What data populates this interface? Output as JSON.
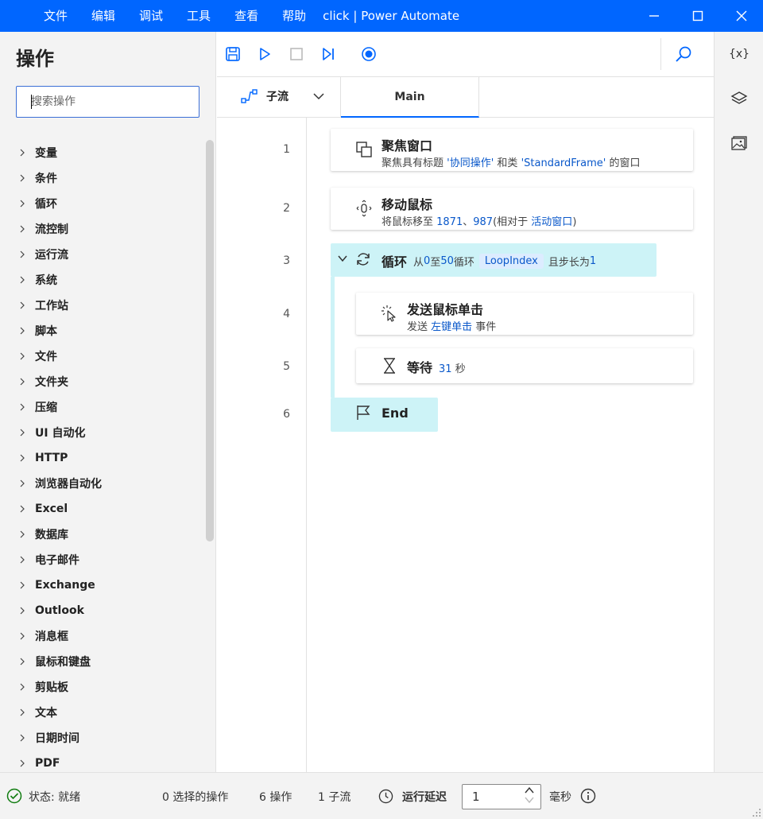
{
  "window": {
    "menu": [
      "文件",
      "编辑",
      "调试",
      "工具",
      "查看",
      "帮助"
    ],
    "title": "click | Power Automate"
  },
  "actions_panel": {
    "heading": "操作",
    "search_placeholder": "搜索操作",
    "categories": [
      "变量",
      "条件",
      "循环",
      "流控制",
      "运行流",
      "系统",
      "工作站",
      "脚本",
      "文件",
      "文件夹",
      "压缩",
      "UI 自动化",
      "HTTP",
      "浏览器自动化",
      "Excel",
      "数据库",
      "电子邮件",
      "Exchange",
      "Outlook",
      "消息框",
      "鼠标和键盘",
      "剪贴板",
      "文本",
      "日期时间",
      "PDF"
    ]
  },
  "tabs": {
    "subflow_label": "子流",
    "main_label": "Main"
  },
  "flow": {
    "line_numbers": [
      "1",
      "2",
      "3",
      "4",
      "5",
      "6"
    ],
    "step1": {
      "title": "聚焦窗口",
      "d1": "聚焦具有标题 ",
      "d2": "'协同操作'",
      "d3": " 和类 ",
      "d4": "'StandardFrame'",
      "d5": " 的窗口"
    },
    "step2": {
      "title": "移动鼠标",
      "d1": "将鼠标移至 ",
      "d2": "1871",
      "d3": "、",
      "d4": "987",
      "d5": "(相对于 ",
      "d6": "活动窗口",
      "d7": ")"
    },
    "step3": {
      "title": "循环",
      "d1": "从 ",
      "d2": "0",
      "d3": " 至 ",
      "d4": "50",
      "d5": " 循环",
      "var": "LoopIndex",
      "d6": "且步长为 ",
      "d7": "1"
    },
    "step4": {
      "title": "发送鼠标单击",
      "d1": "发送 ",
      "d2": "左键单击",
      "d3": " 事件"
    },
    "step5": {
      "title": "等待",
      "d1": "31",
      "d2": " 秒"
    },
    "step6": {
      "title": "End"
    }
  },
  "right_rail": {
    "variables_label": "{x}"
  },
  "status": {
    "state": "状态: 就绪",
    "selected": "0 选择的操作",
    "actions": "6 操作",
    "subflows": "1 子流",
    "delay_label": "运行延迟",
    "delay_value": "1",
    "unit": "毫秒"
  },
  "colors": {
    "accent": "#0066ff",
    "loop_bg": "#cdf3f7",
    "ok_green": "#107c10",
    "link": "#0a58ca"
  }
}
